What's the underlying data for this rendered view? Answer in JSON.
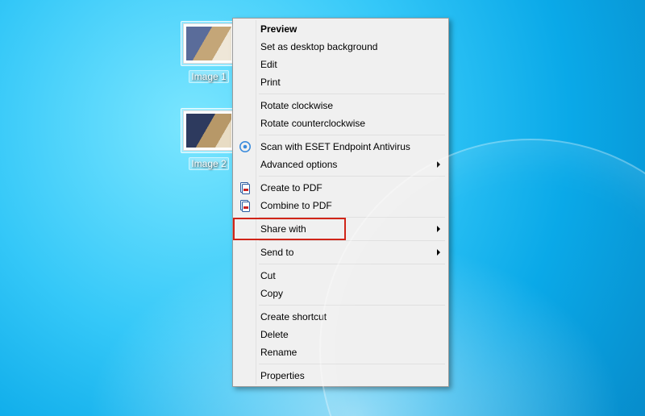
{
  "icons": {
    "image1": {
      "label": "Image 1"
    },
    "image2": {
      "label": "Image 2"
    }
  },
  "menu": {
    "preview": "Preview",
    "set_bg": "Set as desktop background",
    "edit": "Edit",
    "print": "Print",
    "rotate_cw": "Rotate clockwise",
    "rotate_ccw": "Rotate counterclockwise",
    "eset_scan": "Scan with ESET Endpoint Antivirus",
    "eset_adv": "Advanced options",
    "create_pdf": "Create to PDF",
    "combine_pdf": "Combine to PDF",
    "share_with": "Share with",
    "send_to": "Send to",
    "cut": "Cut",
    "copy": "Copy",
    "create_shortcut": "Create shortcut",
    "delete": "Delete",
    "rename": "Rename",
    "properties": "Properties"
  },
  "colors": {
    "callout": "#d02418"
  }
}
